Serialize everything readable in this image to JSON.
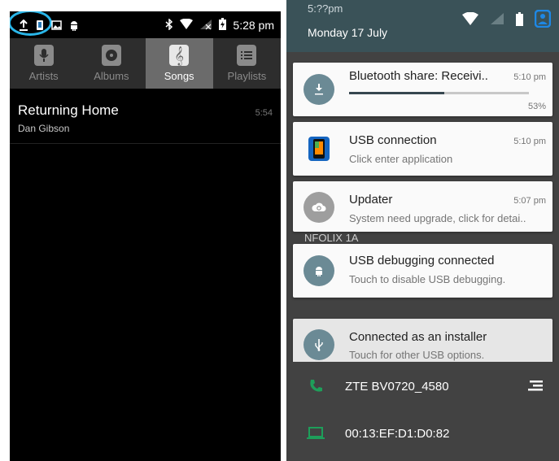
{
  "left": {
    "status_bar": {
      "time": "5:28 pm"
    },
    "tabs": [
      {
        "label": "Artists",
        "icon": "microphone-icon",
        "active": false
      },
      {
        "label": "Albums",
        "icon": "album-icon",
        "active": false
      },
      {
        "label": "Songs",
        "icon": "treble-clef-icon",
        "active": true
      },
      {
        "label": "Playlists",
        "icon": "playlist-icon",
        "active": false
      }
    ],
    "songs": [
      {
        "title": "Returning Home",
        "artist": "Dan Gibson",
        "duration": "5:54"
      }
    ]
  },
  "right": {
    "header": {
      "time": "5:??pm",
      "date": "Monday 17 July"
    },
    "notifications": [
      {
        "title": "Bluetooth share: Receivi..",
        "time": "5:10 pm",
        "progress_label": "53%",
        "progress": 0.53,
        "icon": "download-icon"
      },
      {
        "title": "USB connection",
        "subtitle": "Click enter application",
        "time": "5:10 pm",
        "icon": "usb-app-icon"
      },
      {
        "title": "Updater",
        "subtitle": "System need upgrade, click for detai..",
        "time": "5:07 pm",
        "icon": "cloud-sync-icon"
      },
      {
        "title": "USB debugging connected",
        "subtitle": "Touch to disable USB debugging.",
        "icon": "android-icon"
      },
      {
        "title": "Connected as an installer",
        "subtitle": "Touch for other USB options.",
        "icon": "usb-icon"
      }
    ],
    "obscured_text": "NFOLIX 1A",
    "lower_list": [
      {
        "label": "ZTE BV0720_4580",
        "icon": "phone-icon"
      },
      {
        "label": "00:13:EF:D1:D0:82",
        "icon": "laptop-icon"
      }
    ]
  },
  "colors": {
    "highlight_circle": "#2ab6e9",
    "header_bg": "#3a5258",
    "card_icon_bg": "#6b8a95",
    "accent_user": "#1e88e5"
  }
}
